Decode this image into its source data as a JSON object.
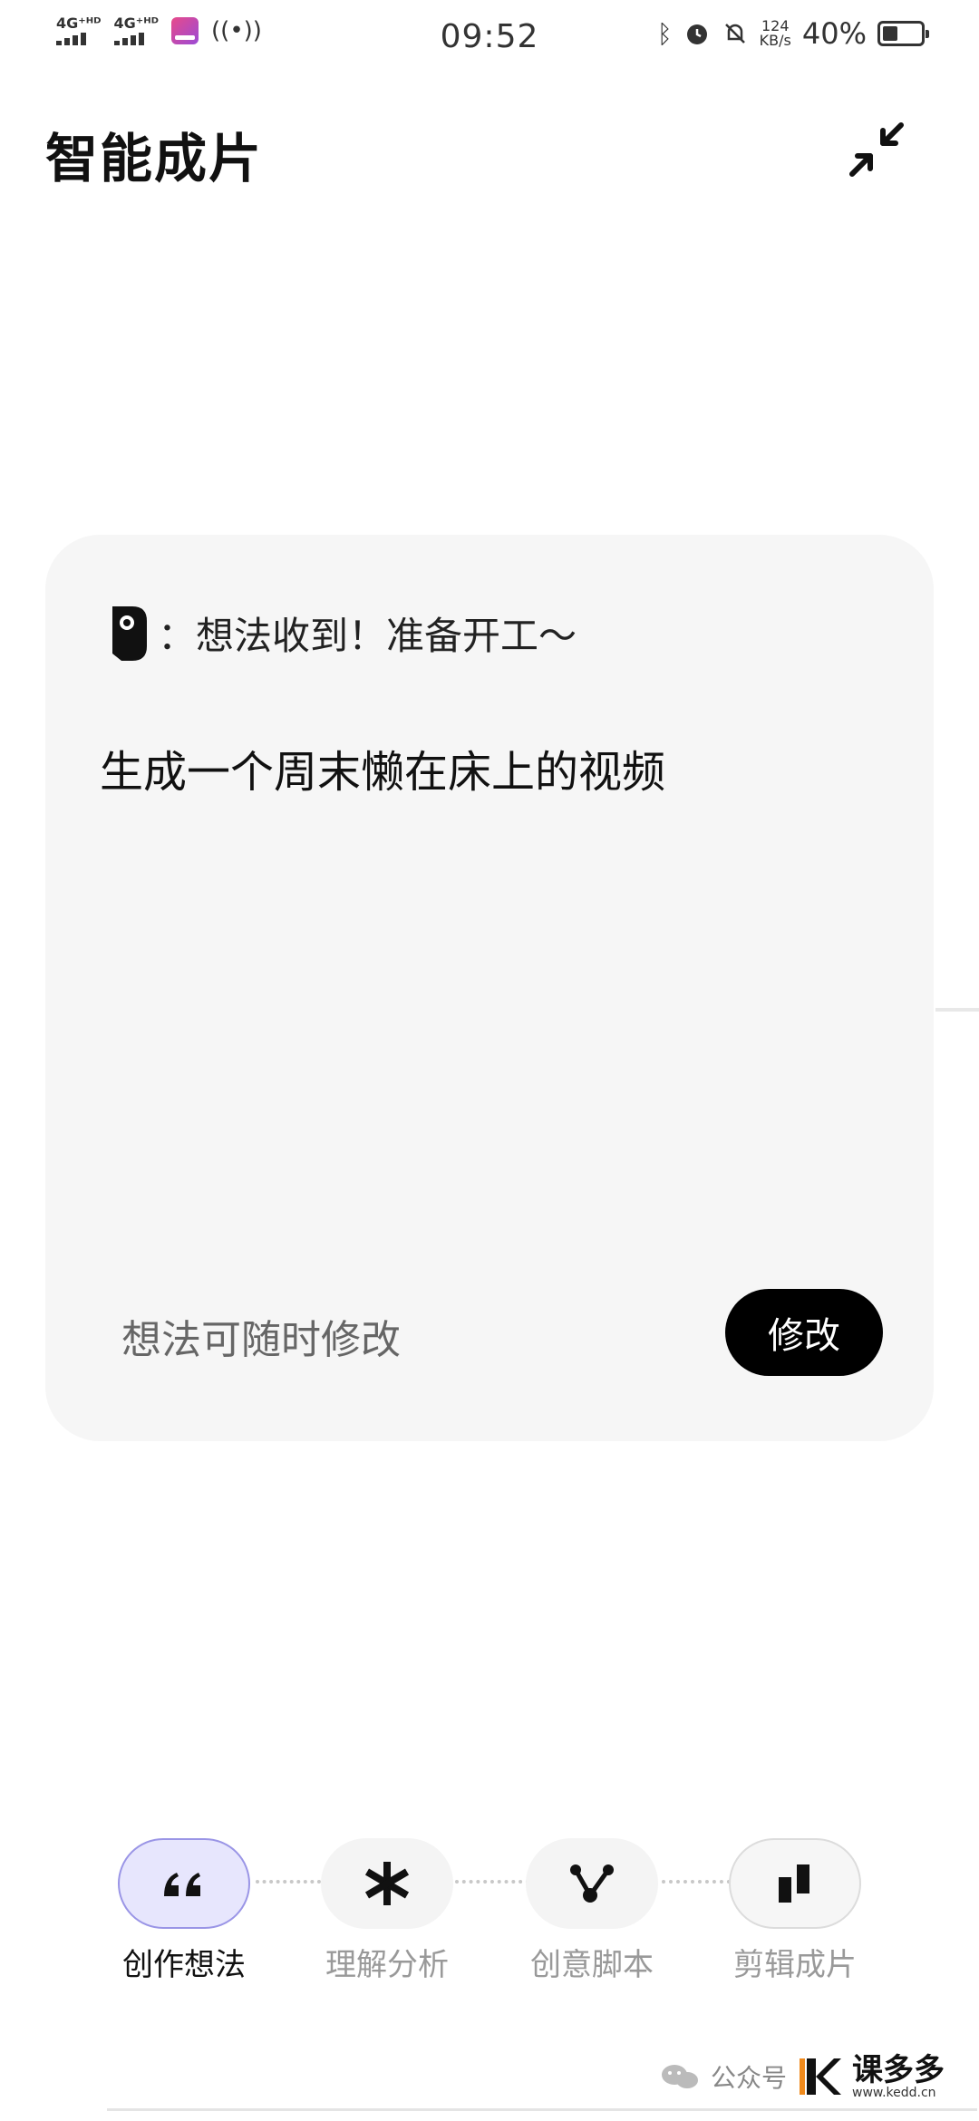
{
  "status_bar": {
    "signal_1": "4G⁺ᴴᴰ",
    "signal_2": "4G⁺ᴴᴰ",
    "time": "09:52",
    "net_speed_value": "124",
    "net_speed_unit": "KB/s",
    "battery_percent": "40%",
    "battery_level": 0.4
  },
  "header": {
    "title": "智能成片"
  },
  "card": {
    "header_text": "：想法收到！准备开工～",
    "prompt": "生成一个周末懒在床上的视频",
    "edit_hint": "想法可随时修改",
    "edit_button_label": "修改"
  },
  "steps": [
    {
      "label": "创作想法",
      "icon": "quote-icon",
      "active": true
    },
    {
      "label": "理解分析",
      "icon": "asterisk-icon",
      "active": false
    },
    {
      "label": "创意脚本",
      "icon": "branch-icon",
      "active": false
    },
    {
      "label": "剪辑成片",
      "icon": "clips-icon",
      "active": false
    }
  ],
  "watermark": {
    "label": "公众号",
    "brand_name": "课多多",
    "brand_url": "www.kedd.cn"
  }
}
